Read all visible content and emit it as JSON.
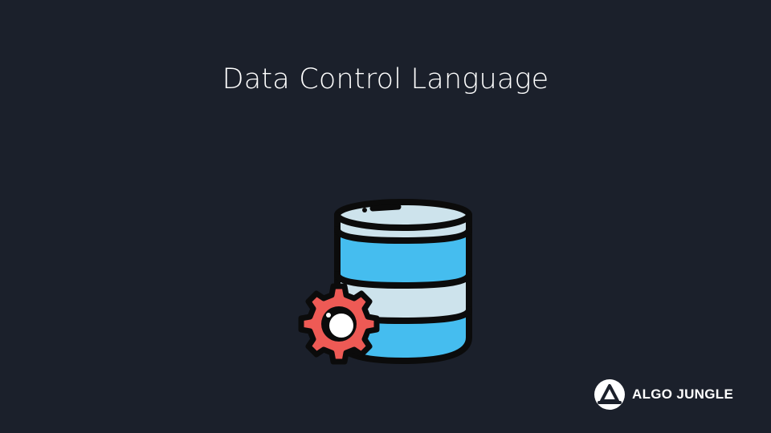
{
  "title": "Data Control Language",
  "icons": {
    "database": "database-icon",
    "gear": "gear-icon",
    "logo": "algo-jungle-logo-icon"
  },
  "brand": {
    "name": "ALGO JUNGLE"
  },
  "colors": {
    "background": "#1b202b",
    "title_text": "#ffffff",
    "db_light": "#cde3ec",
    "db_blue": "#45bdef",
    "gear_red": "#ee5a55",
    "outline": "#0b0b0b",
    "logo_circle": "#ffffff"
  }
}
